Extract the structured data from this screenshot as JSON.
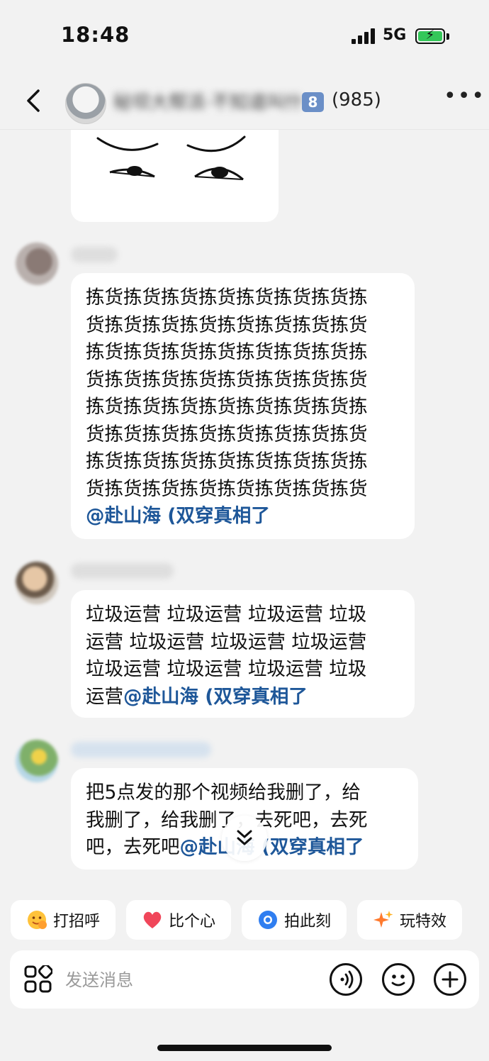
{
  "status_bar": {
    "time": "18:48",
    "network": "5G"
  },
  "header": {
    "group_name": "秘坝大帮派·不知道叫什么好",
    "level_badge": "8",
    "member_count": "(985)"
  },
  "messages": [
    {
      "lines": [
        "拣货拣货拣货拣货拣货拣货拣货拣",
        "货拣货拣货拣货拣货拣货拣货拣货",
        "拣货拣货拣货拣货拣货拣货拣货拣",
        "货拣货拣货拣货拣货拣货拣货拣货",
        "拣货拣货拣货拣货拣货拣货拣货拣",
        "货拣货拣货拣货拣货拣货拣货拣货",
        "拣货拣货拣货拣货拣货拣货拣货拣",
        "货拣货拣货拣货拣货拣货拣货拣货"
      ],
      "mention": "@赴山海 (双穿真相了"
    },
    {
      "lines": [
        "垃圾运营 垃圾运营 垃圾运营 垃圾",
        "运营 垃圾运营 垃圾运营 垃圾运营",
        "垃圾运营 垃圾运营 垃圾运营 垃圾"
      ],
      "last_prefix": "运营",
      "mention": "@赴山海 (双穿真相了"
    },
    {
      "lines": [
        "把5点发的那个视频给我删了，给",
        "我删了，给我删了，去死吧，去死"
      ],
      "last_prefix": "吧，去死吧",
      "mention": "@赴山海 (双穿真相了"
    }
  ],
  "quick_actions": [
    {
      "label": "打招呼",
      "icon": "wave-emoji-icon"
    },
    {
      "label": "比个心",
      "icon": "heart-icon"
    },
    {
      "label": "拍此刻",
      "icon": "camera-icon"
    },
    {
      "label": "玩特效",
      "icon": "sparkle-icon"
    }
  ],
  "composer": {
    "placeholder": "发送消息"
  },
  "colors": {
    "mention": "#1e5799",
    "background": "#f2f2f2",
    "badge": "#6b8fc7",
    "battery": "#34c759"
  }
}
